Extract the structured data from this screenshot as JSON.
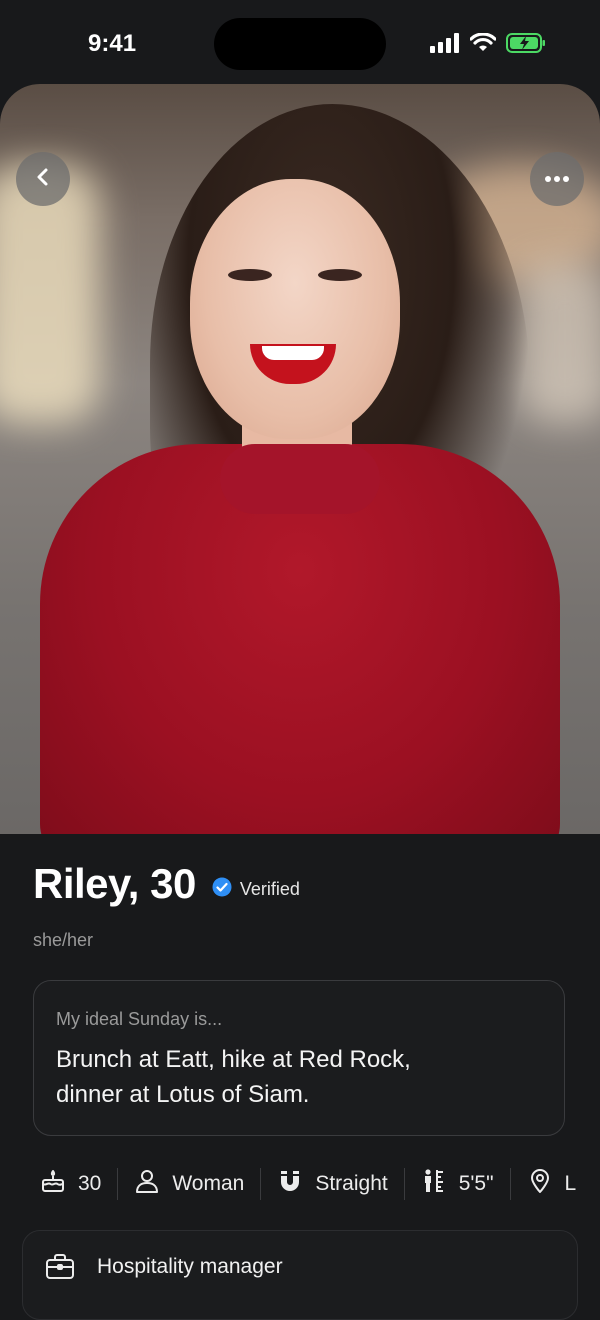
{
  "status_bar": {
    "time": "9:41",
    "icons": [
      "cellular-signal-icon",
      "wifi-icon",
      "battery-charging-icon"
    ]
  },
  "profile": {
    "name_age": "Riley, 30",
    "verified_label": "Verified",
    "pronouns": "she/her",
    "photo_description_icon": "profile-photo"
  },
  "prompt": {
    "question": "My ideal Sunday is...",
    "answer": "Brunch at Eatt, hike at Red Rock, dinner at Lotus of Siam."
  },
  "attributes": [
    {
      "icon": "cake-icon",
      "label": "30"
    },
    {
      "icon": "person-icon",
      "label": "Woman"
    },
    {
      "icon": "magnet-icon",
      "label": "Straight"
    },
    {
      "icon": "height-icon",
      "label": "5'5\""
    },
    {
      "icon": "location-pin-icon",
      "label": "L"
    }
  ],
  "job": {
    "icon": "briefcase-icon",
    "title": "Hospitality manager"
  },
  "colors": {
    "background": "#18191b",
    "verified_badge": "#2f8ff5",
    "sweater": "#a4142a",
    "battery": "#4cd964"
  }
}
